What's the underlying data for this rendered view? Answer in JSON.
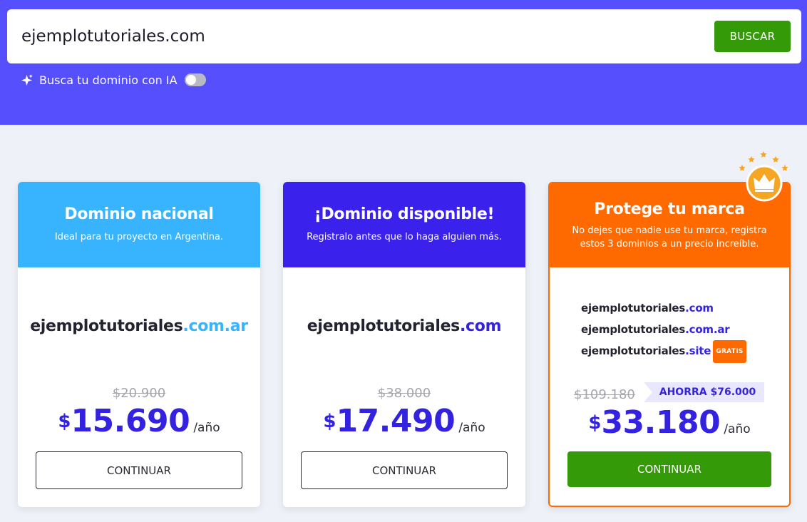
{
  "search": {
    "value": "ejemplotutoriales.com",
    "button_label": "BUSCAR",
    "ai_label": "Busca tu dominio con IA"
  },
  "colors": {
    "hero": "#564ffe",
    "card1_head": "#38b4ff",
    "card2_head": "#3a22ec",
    "card3_head": "#ff6a00",
    "price": "#3322e0",
    "green": "#349a08"
  },
  "cards": [
    {
      "title": "Dominio nacional",
      "subtitle": "Ideal para tu proyecto en Argentina.",
      "domain_name": "ejemplotutoriales",
      "domain_ext": ".com.ar",
      "old_price": "$20.900",
      "currency": "$",
      "price": "15.690",
      "period": "/año",
      "button": "CONTINUAR"
    },
    {
      "title": "¡Dominio disponible!",
      "subtitle": "Registralo antes que lo haga alguien más.",
      "domain_name": "ejemplotutoriales",
      "domain_ext": ".com",
      "old_price": "$38.000",
      "currency": "$",
      "price": "17.490",
      "period": "/año",
      "button": "CONTINUAR"
    },
    {
      "title": "Protege tu marca",
      "subtitle": "No dejes que nadie use tu marca, registra estos 3 dominios a un precio increíble.",
      "bundle": [
        {
          "name": "ejemplotutoriales",
          "ext": ".com",
          "badge": ""
        },
        {
          "name": "ejemplotutoriales",
          "ext": ".com.ar",
          "badge": ""
        },
        {
          "name": "ejemplotutoriales",
          "ext": ".site",
          "badge": "GRATIS"
        }
      ],
      "old_price": "$109.180",
      "savings": "AHORRA $76.000",
      "currency": "$",
      "price": "33.180",
      "period": "/año",
      "button": "CONTINUAR",
      "icon": "crown-icon"
    }
  ]
}
